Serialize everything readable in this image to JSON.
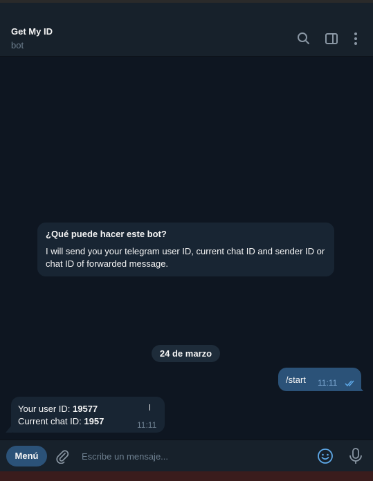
{
  "header": {
    "title": "Get My ID",
    "subtitle": "bot",
    "icons": [
      "search-icon",
      "sidebar-toggle-icon",
      "more-vertical-icon"
    ]
  },
  "intro_card": {
    "question": "¿Qué puede hacer este bot?",
    "description": "I will send you your telegram user ID, current chat ID and sender ID or chat ID of forwarded message."
  },
  "date_separator": "24 de marzo",
  "messages": [
    {
      "direction": "outgoing",
      "text": "/start",
      "time": "11:11",
      "status": "read"
    },
    {
      "direction": "incoming",
      "lines": [
        {
          "label": "Your user ID: ",
          "value": "19577"
        },
        {
          "label": "Current chat ID: ",
          "value": "1957"
        }
      ],
      "time": "11:11"
    }
  ],
  "composer": {
    "menu_label": "Menú",
    "placeholder": "Escribe un mensaje...",
    "value": ""
  },
  "colors": {
    "background": "#0e1621",
    "header": "#17212b",
    "incoming_bubble": "#182533",
    "outgoing_bubble": "#2b5278",
    "accent": "#5ea9e8"
  }
}
